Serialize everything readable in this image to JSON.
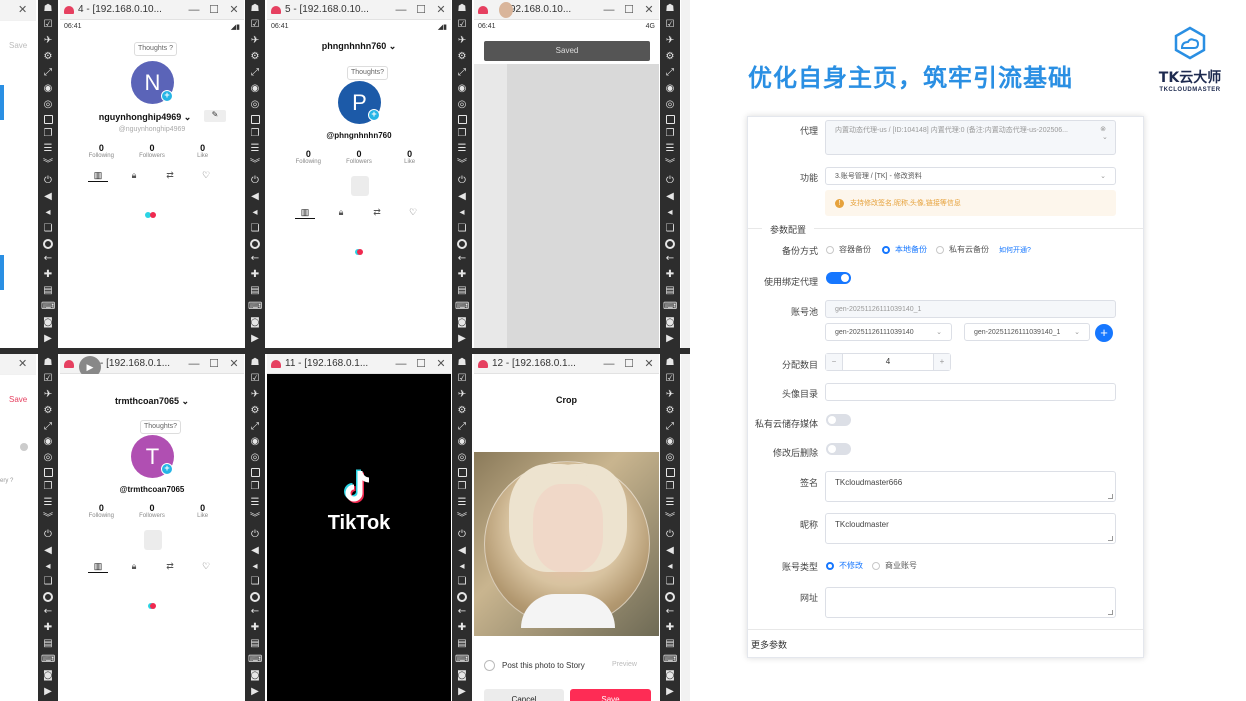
{
  "left_fragments": {
    "save_top": "Save",
    "save_bottom": "Save",
    "fragment_text": "ery ?"
  },
  "windows": [
    {
      "title": "4 - [192.168.0.10...",
      "time": "06:41",
      "thought": "Thoughts ?",
      "avatar_letter": "N",
      "username": "nguynhonghip4969 ⌄",
      "handle": "@nguynhonghip4969",
      "stats": [
        {
          "n": "0",
          "l": "Following"
        },
        {
          "n": "0",
          "l": "Followers"
        },
        {
          "n": "0",
          "l": "Like"
        }
      ]
    },
    {
      "title": "5 - [192.168.0.10...",
      "time": "06:41",
      "thought": "Thoughts?",
      "avatar_letter": "P",
      "username": "phngnhnhn760 ⌄",
      "handle": "@phngnhnhn760",
      "stats": [
        {
          "n": "0",
          "l": "Following"
        },
        {
          "n": "0",
          "l": "Followers"
        },
        {
          "n": "0",
          "l": "Like"
        }
      ]
    },
    {
      "title": "92.168.0.10...",
      "time": "06:41",
      "status_right": "4G",
      "saved_toast": "Saved"
    },
    {
      "title": "- [192.168.0.1...",
      "thought": "Thoughts?",
      "avatar_letter": "T",
      "username": "trmthcoan7065 ⌄",
      "handle": "@trmthcoan7065",
      "stats": [
        {
          "n": "0",
          "l": "Following"
        },
        {
          "n": "0",
          "l": "Followers"
        },
        {
          "n": "0",
          "l": "Like"
        }
      ]
    },
    {
      "title": "11 - [192.168.0.1...",
      "splash_text": "TikTok"
    },
    {
      "title": "12 - [192.168.0.1...",
      "crop_title": "Crop",
      "post_story": "Post this photo to Story",
      "preview": "Preview",
      "cancel": "Cancel",
      "save": "Save"
    }
  ],
  "right": {
    "heading": "优化自身主页，筑牢引流基础",
    "logo_name": "TK云大师",
    "logo_sub": "TKCLOUDMASTER",
    "form": {
      "proxy_label": "代理",
      "proxy_value": "内置动态代理-us / [ID:104148] 内置代理:0 (备注:内置动态代理-us-202506...",
      "func_label": "功能",
      "func_value": "3.账号管理 / [TK] - 修改资料",
      "notice": "支持修改签名,昵称,头像,链接等信息",
      "section": "参数配置",
      "backup_label": "备份方式",
      "backup_opts": [
        "容器备份",
        "本地备份",
        "私有云备份"
      ],
      "backup_link": "如何开通?",
      "bind_proxy_label": "使用绑定代理",
      "pool_label": "账号池",
      "pool_value": "gen-20251126111039140_1",
      "pool_sel1": "gen-20251126111039140",
      "pool_sel2": "gen-20251126111039140_1",
      "alloc_label": "分配数目",
      "alloc_value": "4",
      "avatar_dir_label": "头像目录",
      "private_media_label": "私有云储存媒体",
      "delete_after_label": "修改后删除",
      "signature_label": "签名",
      "signature_value": "TKcloudmaster666",
      "nickname_label": "昵称",
      "nickname_value": "TKcloudmaster",
      "acct_type_label": "账号类型",
      "acct_type_opts": [
        "不修改",
        "商业账号"
      ],
      "url_label": "网址",
      "more_params": "更多参数"
    }
  },
  "colors": {
    "accent": "#1677ff",
    "heading": "#2a8fe3",
    "tiktok_pink": "#f0294f",
    "tiktok_cyan": "#2bd4e4"
  }
}
